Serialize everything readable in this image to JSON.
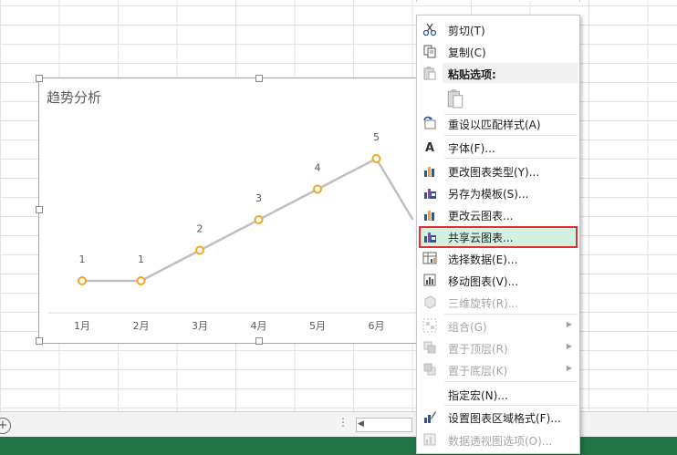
{
  "chart": {
    "title": "趋势分析",
    "chart_data": {
      "type": "line",
      "categories": [
        "1月",
        "2月",
        "3月",
        "4月",
        "5月",
        "6月"
      ],
      "values": [
        1,
        1,
        2,
        3,
        4,
        5
      ],
      "data_labels": [
        "1",
        "1",
        "2",
        "3",
        "4",
        "5"
      ],
      "line_color": "#bfbfbf",
      "marker_color": "#f5a623"
    }
  },
  "menu": {
    "items": [
      {
        "label": "剪切(T)",
        "icon": "scissors-icon"
      },
      {
        "label": "复制(C)",
        "icon": "copy-icon"
      },
      {
        "label": "粘贴选项:",
        "icon": "paste-icon"
      },
      {
        "label": "",
        "icon": "paste-option-icon"
      },
      {
        "label": "重设以匹配样式(A)",
        "icon": "reset-style-icon"
      },
      {
        "label": "字体(F)...",
        "icon": "font-icon"
      },
      {
        "label": "更改图表类型(Y)...",
        "icon": "chart-type-icon"
      },
      {
        "label": "另存为模板(S)...",
        "icon": "save-template-icon"
      },
      {
        "label": "更改云图表...",
        "icon": "cloud-chart-icon"
      },
      {
        "label": "共享云图表...",
        "icon": "share-cloud-chart-icon"
      },
      {
        "label": "选择数据(E)...",
        "icon": "select-data-icon"
      },
      {
        "label": "移动图表(V)...",
        "icon": "move-chart-icon"
      },
      {
        "label": "三维旋转(R)...",
        "icon": "3d-rotate-icon"
      },
      {
        "label": "组合(G)",
        "icon": "group-icon"
      },
      {
        "label": "置于顶层(R)",
        "icon": "bring-front-icon"
      },
      {
        "label": "置于底层(K)",
        "icon": "send-back-icon"
      },
      {
        "label": "指定宏(N)...",
        "icon": "macro-icon"
      },
      {
        "label": "设置图表区域格式(F)...",
        "icon": "format-chart-icon"
      },
      {
        "label": "数据透视图选项(O)...",
        "icon": "pivot-options-icon"
      }
    ]
  },
  "sheetbar": {
    "add": "+",
    "dots": "⋮",
    "scroll_left": "◀"
  }
}
